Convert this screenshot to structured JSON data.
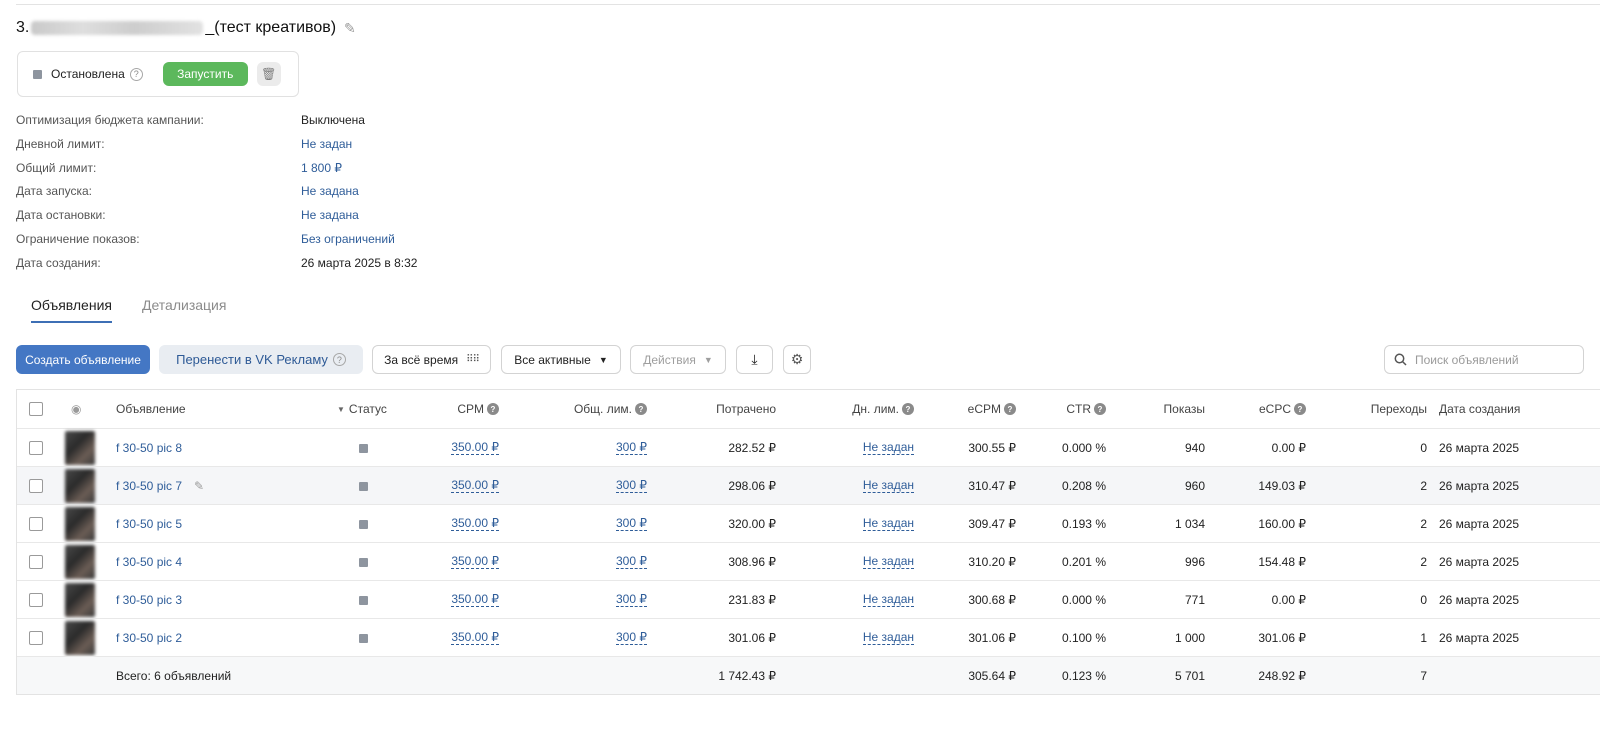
{
  "campaign": {
    "number_prefix": "3.",
    "title_suffix": "_(тест креативов)",
    "status_label": "Остановлена",
    "start_button": "Запустить"
  },
  "info": [
    {
      "key": "Оптимизация бюджета кампании:",
      "value": "Выключена",
      "link": false
    },
    {
      "key": "Дневной лимит:",
      "value": "Не задан",
      "link": true
    },
    {
      "key": "Общий лимит:",
      "value": "1 800 ₽",
      "link": true
    },
    {
      "key": "Дата запуска:",
      "value": "Не задана",
      "link": true
    },
    {
      "key": "Дата остановки:",
      "value": "Не задана",
      "link": true
    },
    {
      "key": "Ограничение показов:",
      "value": "Без ограничений",
      "link": true
    },
    {
      "key": "Дата создания:",
      "value": "26 марта 2025 в 8:32",
      "link": false
    }
  ],
  "tabs": [
    "Объявления",
    "Детализация"
  ],
  "toolbar": {
    "create": "Создать объявление",
    "move": "Перенести в VK Рекламу",
    "period": "За всё время",
    "filter": "Все активные",
    "actions": "Действия",
    "search_placeholder": "Поиск объявлений"
  },
  "columns": {
    "ad": "Объявление",
    "status": "Статус",
    "cpm": "CPM",
    "total_limit": "Общ. лим.",
    "spent": "Потрачено",
    "daily_limit": "Дн. лим.",
    "ecpm": "eCPM",
    "ctr": "CTR",
    "impressions": "Показы",
    "ecpc": "eCPC",
    "clicks": "Переходы",
    "created": "Дата создания"
  },
  "rows": [
    {
      "name": "f 30-50 pic 8",
      "cpm": "350.00 ₽",
      "total_limit": "300 ₽",
      "spent": "282.52 ₽",
      "daily_limit": "Не задан",
      "ecpm": "300.55 ₽",
      "ctr": "0.000 %",
      "impressions": "940",
      "ecpc": "0.00 ₽",
      "clicks": "0",
      "created": "26 марта 2025"
    },
    {
      "name": "f 30-50 pic 7",
      "cpm": "350.00 ₽",
      "total_limit": "300 ₽",
      "spent": "298.06 ₽",
      "daily_limit": "Не задан",
      "ecpm": "310.47 ₽",
      "ctr": "0.208 %",
      "impressions": "960",
      "ecpc": "149.03 ₽",
      "clicks": "2",
      "created": "26 марта 2025"
    },
    {
      "name": "f 30-50 pic 5",
      "cpm": "350.00 ₽",
      "total_limit": "300 ₽",
      "spent": "320.00 ₽",
      "daily_limit": "Не задан",
      "ecpm": "309.47 ₽",
      "ctr": "0.193 %",
      "impressions": "1 034",
      "ecpc": "160.00 ₽",
      "clicks": "2",
      "created": "26 марта 2025"
    },
    {
      "name": "f 30-50 pic 4",
      "cpm": "350.00 ₽",
      "total_limit": "300 ₽",
      "spent": "308.96 ₽",
      "daily_limit": "Не задан",
      "ecpm": "310.20 ₽",
      "ctr": "0.201 %",
      "impressions": "996",
      "ecpc": "154.48 ₽",
      "clicks": "2",
      "created": "26 марта 2025"
    },
    {
      "name": "f 30-50 pic 3",
      "cpm": "350.00 ₽",
      "total_limit": "300 ₽",
      "spent": "231.83 ₽",
      "daily_limit": "Не задан",
      "ecpm": "300.68 ₽",
      "ctr": "0.000 %",
      "impressions": "771",
      "ecpc": "0.00 ₽",
      "clicks": "0",
      "created": "26 марта 2025"
    },
    {
      "name": "f 30-50 pic 2",
      "cpm": "350.00 ₽",
      "total_limit": "300 ₽",
      "spent": "301.06 ₽",
      "daily_limit": "Не задан",
      "ecpm": "301.06 ₽",
      "ctr": "0.100 %",
      "impressions": "1 000",
      "ecpc": "301.06 ₽",
      "clicks": "1",
      "created": "26 марта 2025"
    }
  ],
  "totals": {
    "label": "Всего: 6 объявлений",
    "spent": "1 742.43 ₽",
    "ecpm": "305.64 ₽",
    "ctr": "0.123 %",
    "impressions": "5 701",
    "ecpc": "248.92 ₽",
    "clicks": "7"
  },
  "colors": {
    "accent": "#4477c4",
    "start": "#5cb85c",
    "link": "#2f5d99",
    "status_stopped": "#8e959f"
  }
}
